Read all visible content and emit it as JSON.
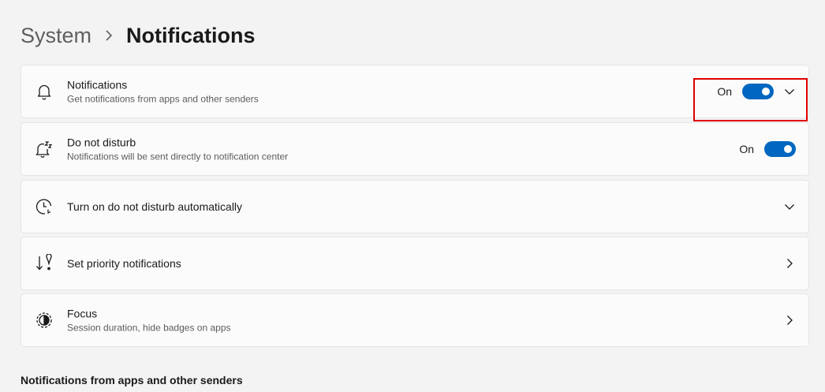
{
  "breadcrumb": {
    "parent": "System",
    "current": "Notifications"
  },
  "cards": {
    "notifications": {
      "title": "Notifications",
      "subtitle": "Get notifications from apps and other senders",
      "toggle_state": "On",
      "icon": "bell-icon"
    },
    "do_not_disturb": {
      "title": "Do not disturb",
      "subtitle": "Notifications will be sent directly to notification center",
      "toggle_state": "On",
      "icon": "bell-snooze-icon"
    },
    "auto_dnd": {
      "title": "Turn on do not disturb automatically",
      "icon": "clock-icon"
    },
    "priority": {
      "title": "Set priority notifications",
      "icon": "priority-icon"
    },
    "focus": {
      "title": "Focus",
      "subtitle": "Session duration, hide badges on apps",
      "icon": "focus-icon"
    }
  },
  "section": {
    "heading": "Notifications from apps and other senders"
  },
  "colors": {
    "accent": "#0067c0",
    "highlight": "#e00000",
    "background": "#f3f3f3",
    "card": "#fbfbfb"
  }
}
